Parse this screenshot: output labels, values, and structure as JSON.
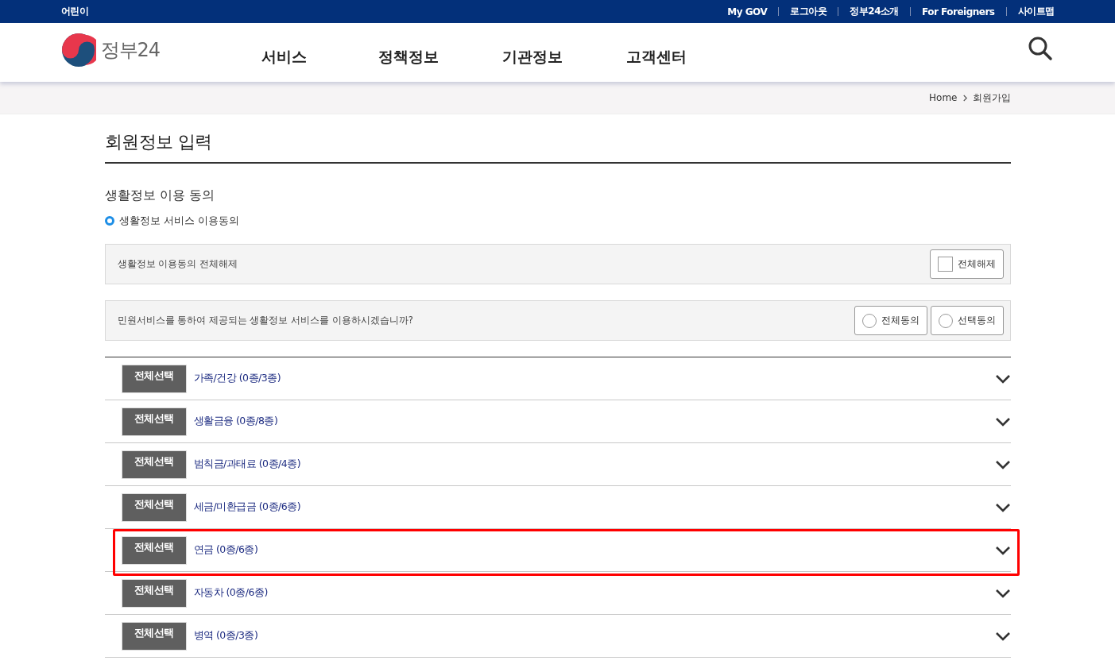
{
  "top_bar": {
    "left_link": "어린이",
    "links": [
      "My GOV",
      "로그아웃",
      "정부24소개",
      "For Foreigners",
      "사이트맵"
    ]
  },
  "header": {
    "logo_text": "정부24",
    "nav": [
      "서비스",
      "정책정보",
      "기관정보",
      "고객센터"
    ]
  },
  "breadcrumb": [
    "Home",
    "회원가입"
  ],
  "page_title": "회원정보 입력",
  "section_title": "생활정보 이용 동의",
  "subsection_title": "생활정보 서비스 이용동의",
  "release_box": {
    "text": "생활정보 이용동의 전체해제",
    "checkbox": {
      "label": "전체해제",
      "checked": false
    }
  },
  "consent_box": {
    "text": "민원서비스를 통하여 제공되는 생활정보 서비스를 이용하시겠습니까?",
    "options": [
      {
        "label": "전체동의",
        "selected": false
      },
      {
        "label": "선택동의",
        "selected": false
      }
    ]
  },
  "categories": [
    {
      "button": "전체선택",
      "label": "가족/건강 (0종/3종)",
      "expanded": false,
      "highlighted": false
    },
    {
      "button": "전체선택",
      "label": "생활금융 (0종/8종)",
      "expanded": false,
      "highlighted": false
    },
    {
      "button": "전체선택",
      "label": "범칙금/과태료 (0종/4종)",
      "expanded": false,
      "highlighted": false
    },
    {
      "button": "전체선택",
      "label": "세금/미환급금 (0종/6종)",
      "expanded": false,
      "highlighted": false
    },
    {
      "button": "전체선택",
      "label": "연금 (0종/6종)",
      "expanded": false,
      "highlighted": true
    },
    {
      "button": "전체선택",
      "label": "자동차 (0종/6종)",
      "expanded": false,
      "highlighted": false
    },
    {
      "button": "전체선택",
      "label": "병역 (0종/3종)",
      "expanded": false,
      "highlighted": false
    }
  ]
}
